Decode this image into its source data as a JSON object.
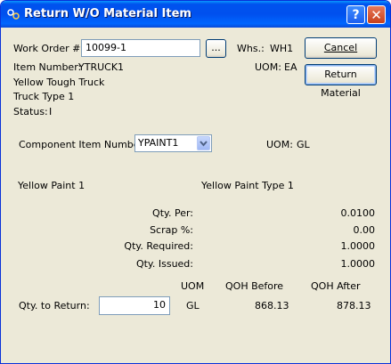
{
  "window": {
    "title": "Return W/O Material Item"
  },
  "header": {
    "work_order_label": "Work Order #:",
    "work_order_value": "10099-1",
    "lookup_label": "...",
    "whs_label": "Whs.:",
    "whs_value": "WH1",
    "item_number_label": "Item Number:",
    "item_number_value": "YTRUCK1",
    "uom_label": "UOM:",
    "uom_value": "EA",
    "description1": "Yellow Tough Truck",
    "description2": "Truck Type 1",
    "status_label": "Status:",
    "status_value": "I"
  },
  "buttons": {
    "cancel": "Cancel",
    "return_material": "Return Material"
  },
  "component": {
    "label": "Component Item Number:",
    "value": "YPAINT1",
    "uom_label": "UOM:",
    "uom_value": "GL",
    "description1": "Yellow Paint 1",
    "description2": "Yellow Paint Type 1"
  },
  "quantities": {
    "qty_per_label": "Qty. Per:",
    "qty_per_value": "0.0100",
    "scrap_label": "Scrap %:",
    "scrap_value": "0.00",
    "required_label": "Qty. Required:",
    "required_value": "1.0000",
    "issued_label": "Qty. Issued:",
    "issued_value": "1.0000"
  },
  "return_table": {
    "col_uom": "UOM",
    "col_qoh_before": "QOH Before",
    "col_qoh_after": "QOH After",
    "qty_to_return_label": "Qty. to Return:",
    "qty_to_return_value": "10",
    "uom_value": "GL",
    "qoh_before_value": "868.13",
    "qoh_after_value": "878.13"
  }
}
